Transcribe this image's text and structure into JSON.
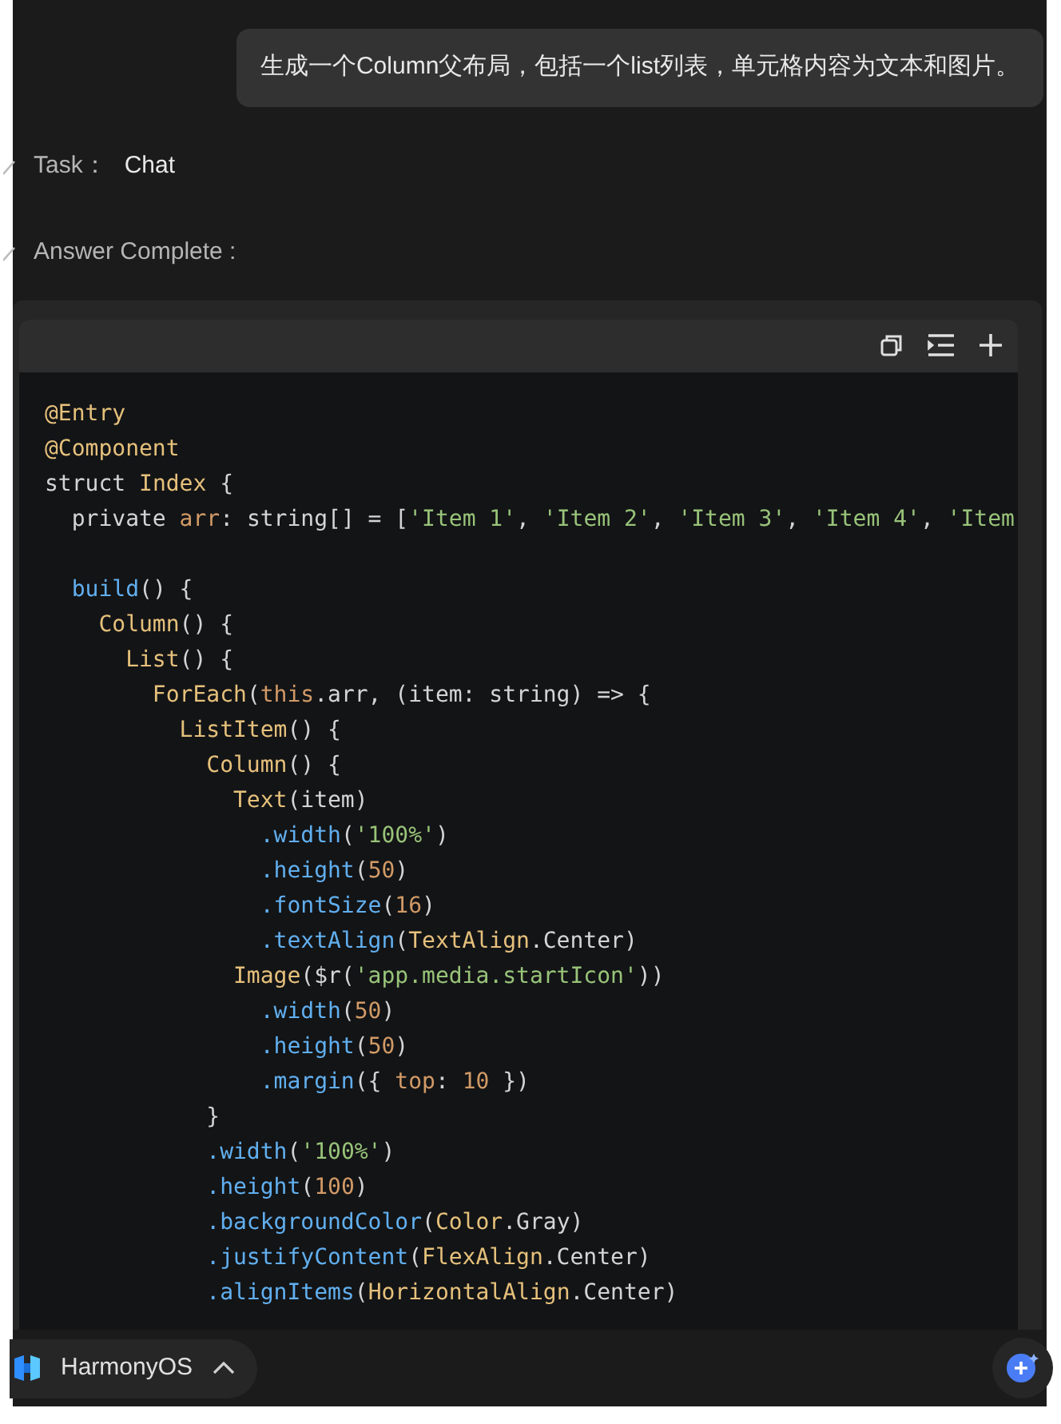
{
  "prompt": {
    "text": "生成一个Column父布局，包括一个list列表，单元格内容为文本和图片。"
  },
  "steps": [
    {
      "label": "Task：",
      "value": "Chat",
      "done": true
    },
    {
      "label": "Answer Complete :",
      "done": true
    }
  ],
  "code_block": {
    "lines": [
      {
        "kind": "code",
        "tokens": [
          {
            "kind": "type",
            "text": "@Entry"
          }
        ]
      },
      {
        "kind": "code",
        "tokens": [
          {
            "kind": "type",
            "text": "@Component"
          }
        ]
      },
      {
        "kind": "code",
        "tokens": [
          {
            "kind": "plain",
            "text": "struct "
          },
          {
            "kind": "type",
            "text": "Index"
          },
          {
            "kind": "plain",
            "text": " {"
          }
        ]
      },
      {
        "kind": "code",
        "tokens": [
          {
            "kind": "plain",
            "text": "  private "
          },
          {
            "kind": "prop",
            "text": "arr"
          },
          {
            "kind": "plain",
            "text": ": string[] = ["
          },
          {
            "kind": "str",
            "text": "'Item 1'"
          },
          {
            "kind": "plain",
            "text": ", "
          },
          {
            "kind": "str",
            "text": "'Item 2'"
          },
          {
            "kind": "plain",
            "text": ", "
          },
          {
            "kind": "str",
            "text": "'Item 3'"
          },
          {
            "kind": "plain",
            "text": ", "
          },
          {
            "kind": "str",
            "text": "'Item 4'"
          },
          {
            "kind": "plain",
            "text": ", "
          },
          {
            "kind": "str",
            "text": "'Item"
          }
        ]
      },
      {
        "kind": "blank"
      },
      {
        "kind": "code",
        "tokens": [
          {
            "kind": "fn",
            "text": "  build"
          },
          {
            "kind": "plain",
            "text": "() {"
          }
        ]
      },
      {
        "kind": "code",
        "tokens": [
          {
            "kind": "type",
            "text": "    Column"
          },
          {
            "kind": "plain",
            "text": "() {"
          }
        ]
      },
      {
        "kind": "code",
        "tokens": [
          {
            "kind": "type",
            "text": "      List"
          },
          {
            "kind": "plain",
            "text": "() {"
          }
        ]
      },
      {
        "kind": "code",
        "tokens": [
          {
            "kind": "type",
            "text": "        ForEach"
          },
          {
            "kind": "plain",
            "text": "("
          },
          {
            "kind": "prop",
            "text": "this"
          },
          {
            "kind": "plain",
            "text": ".arr, (item: string) => {"
          }
        ]
      },
      {
        "kind": "code",
        "tokens": [
          {
            "kind": "type",
            "text": "          ListItem"
          },
          {
            "kind": "plain",
            "text": "() {"
          }
        ]
      },
      {
        "kind": "code",
        "tokens": [
          {
            "kind": "type",
            "text": "            Column"
          },
          {
            "kind": "plain",
            "text": "() {"
          }
        ]
      },
      {
        "kind": "code",
        "tokens": [
          {
            "kind": "type",
            "text": "              Text"
          },
          {
            "kind": "plain",
            "text": "(item)"
          }
        ]
      },
      {
        "kind": "code",
        "tokens": [
          {
            "kind": "fn",
            "text": "                .width"
          },
          {
            "kind": "plain",
            "text": "("
          },
          {
            "kind": "str",
            "text": "'100%'"
          },
          {
            "kind": "plain",
            "text": ")"
          }
        ]
      },
      {
        "kind": "code",
        "tokens": [
          {
            "kind": "fn",
            "text": "                .height"
          },
          {
            "kind": "plain",
            "text": "("
          },
          {
            "kind": "num",
            "text": "50"
          },
          {
            "kind": "plain",
            "text": ")"
          }
        ]
      },
      {
        "kind": "code",
        "tokens": [
          {
            "kind": "fn",
            "text": "                .fontSize"
          },
          {
            "kind": "plain",
            "text": "("
          },
          {
            "kind": "num",
            "text": "16"
          },
          {
            "kind": "plain",
            "text": ")"
          }
        ]
      },
      {
        "kind": "code",
        "tokens": [
          {
            "kind": "fn",
            "text": "                .textAlign"
          },
          {
            "kind": "plain",
            "text": "("
          },
          {
            "kind": "type",
            "text": "TextAlign"
          },
          {
            "kind": "plain",
            "text": ".Center)"
          }
        ]
      },
      {
        "kind": "code",
        "tokens": [
          {
            "kind": "type",
            "text": "              Image"
          },
          {
            "kind": "plain",
            "text": "($r("
          },
          {
            "kind": "str",
            "text": "'app.media.startIcon'"
          },
          {
            "kind": "plain",
            "text": "))"
          }
        ]
      },
      {
        "kind": "code",
        "tokens": [
          {
            "kind": "fn",
            "text": "                .width"
          },
          {
            "kind": "plain",
            "text": "("
          },
          {
            "kind": "num",
            "text": "50"
          },
          {
            "kind": "plain",
            "text": ")"
          }
        ]
      },
      {
        "kind": "code",
        "tokens": [
          {
            "kind": "fn",
            "text": "                .height"
          },
          {
            "kind": "plain",
            "text": "("
          },
          {
            "kind": "num",
            "text": "50"
          },
          {
            "kind": "plain",
            "text": ")"
          }
        ]
      },
      {
        "kind": "code",
        "tokens": [
          {
            "kind": "fn",
            "text": "                .margin"
          },
          {
            "kind": "plain",
            "text": "({ "
          },
          {
            "kind": "prop",
            "text": "top"
          },
          {
            "kind": "plain",
            "text": ": "
          },
          {
            "kind": "num",
            "text": "10"
          },
          {
            "kind": "plain",
            "text": " })"
          }
        ]
      },
      {
        "kind": "code",
        "tokens": [
          {
            "kind": "plain",
            "text": "            }"
          }
        ]
      },
      {
        "kind": "code",
        "tokens": [
          {
            "kind": "fn",
            "text": "            .width"
          },
          {
            "kind": "plain",
            "text": "("
          },
          {
            "kind": "str",
            "text": "'100%'"
          },
          {
            "kind": "plain",
            "text": ")"
          }
        ]
      },
      {
        "kind": "code",
        "tokens": [
          {
            "kind": "fn",
            "text": "            .height"
          },
          {
            "kind": "plain",
            "text": "("
          },
          {
            "kind": "num",
            "text": "100"
          },
          {
            "kind": "plain",
            "text": ")"
          }
        ]
      },
      {
        "kind": "code",
        "tokens": [
          {
            "kind": "fn",
            "text": "            .backgroundColor"
          },
          {
            "kind": "plain",
            "text": "("
          },
          {
            "kind": "type",
            "text": "Color"
          },
          {
            "kind": "plain",
            "text": ".Gray)"
          }
        ]
      },
      {
        "kind": "code",
        "tokens": [
          {
            "kind": "fn",
            "text": "            .justifyContent"
          },
          {
            "kind": "plain",
            "text": "("
          },
          {
            "kind": "type",
            "text": "FlexAlign"
          },
          {
            "kind": "plain",
            "text": ".Center)"
          }
        ]
      },
      {
        "kind": "code",
        "tokens": [
          {
            "kind": "fn",
            "text": "            .alignItems"
          },
          {
            "kind": "plain",
            "text": "("
          },
          {
            "kind": "type",
            "text": "HorizontalAlign"
          },
          {
            "kind": "plain",
            "text": ".Center)"
          }
        ]
      }
    ]
  },
  "footer": {
    "selector": "HarmonyOS"
  }
}
